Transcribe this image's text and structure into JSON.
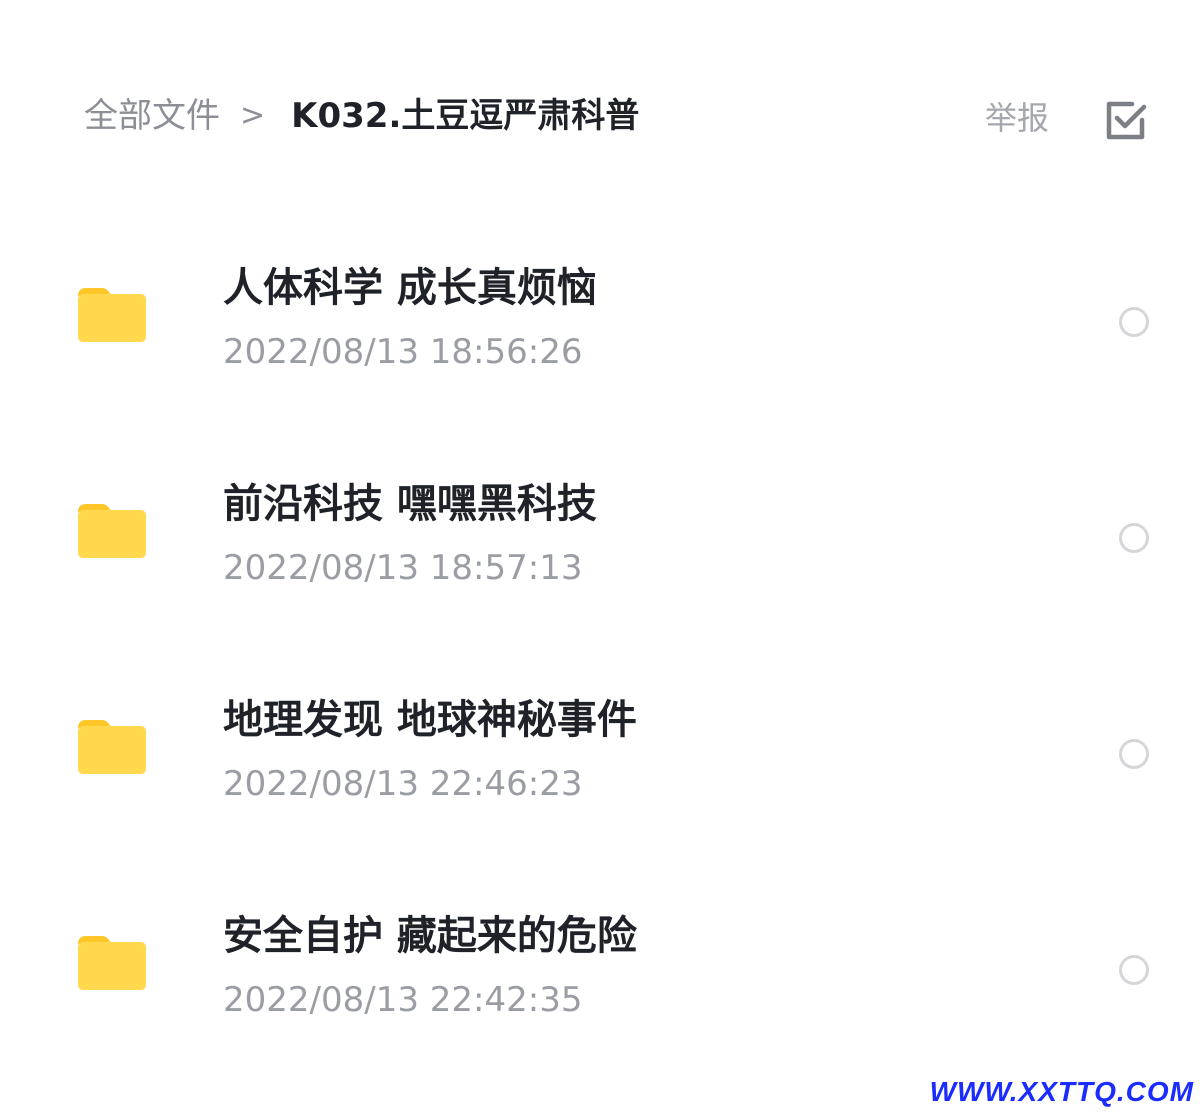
{
  "header": {
    "breadcrumb_root": "全部文件",
    "breadcrumb_separator": ">",
    "breadcrumb_current": "K032.土豆逗严肃科普",
    "report_label": "举报",
    "select_icon": "checkbox-check-icon"
  },
  "items": [
    {
      "name": "人体科学 成长真烦恼",
      "date": "2022/08/13 18:56:26",
      "icon": "folder-icon"
    },
    {
      "name": "前沿科技 嘿嘿黑科技",
      "date": "2022/08/13 18:57:13",
      "icon": "folder-icon"
    },
    {
      "name": "地理发现 地球神秘事件",
      "date": "2022/08/13 22:46:23",
      "icon": "folder-icon"
    },
    {
      "name": "安全自护 藏起来的危险",
      "date": "2022/08/13 22:42:35",
      "icon": "folder-icon"
    }
  ],
  "watermark": "WWW.XXTTQ.COM",
  "colors": {
    "folder_front": "#ffd84d",
    "folder_back": "#ffc629",
    "title_text": "#1f2329",
    "secondary_text": "#9a9da3"
  }
}
